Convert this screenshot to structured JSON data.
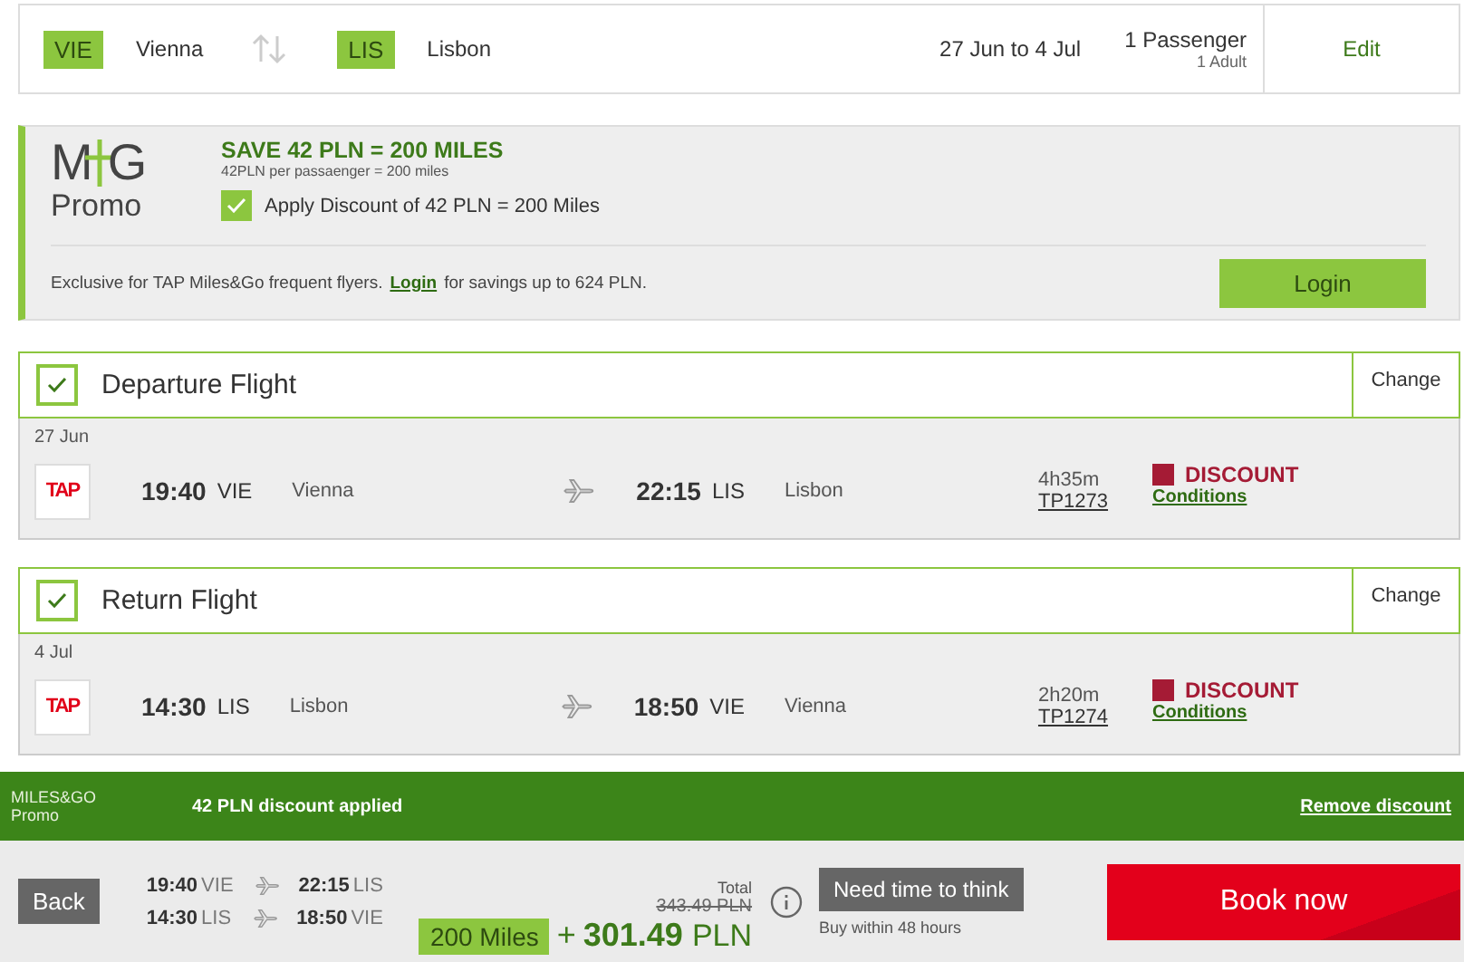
{
  "search_summary": {
    "origin_code": "VIE",
    "origin_city": "Vienna",
    "destination_code": "LIS",
    "destination_city": "Lisbon",
    "dates": "27 Jun to 4 Jul",
    "passengers": "1 Passenger",
    "passenger_detail": "1 Adult",
    "edit": "Edit"
  },
  "promo": {
    "logo": {
      "left": "M",
      "right": "G",
      "caption": "Promo"
    },
    "title": "SAVE 42 PLN = 200 MILES",
    "subtitle": "42PLN per passaenger = 200 miles",
    "apply_label": "Apply Discount of 42 PLN = 200 Miles",
    "apply_checked": true,
    "note_before": "Exclusive for TAP Miles&Go frequent flyers.",
    "note_link": "Login",
    "note_after": "for savings up to 624 PLN.",
    "login_button": "Login"
  },
  "flights": [
    {
      "title": "Departure Flight",
      "checked": true,
      "change": "Change",
      "date": "27 Jun",
      "airline": "TAP",
      "dep_time": "19:40",
      "dep_code": "VIE",
      "dep_city": "Vienna",
      "arr_time": "22:15",
      "arr_code": "LIS",
      "arr_city": "Lisbon",
      "duration": "4h35m",
      "flight_number": "TP1273",
      "fare": "DISCOUNT",
      "conditions": "Conditions"
    },
    {
      "title": "Return Flight",
      "checked": true,
      "change": "Change",
      "date": "4 Jul",
      "airline": "TAP",
      "dep_time": "14:30",
      "dep_code": "LIS",
      "dep_city": "Lisbon",
      "arr_time": "18:50",
      "arr_code": "VIE",
      "arr_city": "Vienna",
      "duration": "2h20m",
      "flight_number": "TP1274",
      "fare": "DISCOUNT",
      "conditions": "Conditions"
    }
  ],
  "discount_bar": {
    "brand": "MILES&GO",
    "brand_caption": "Promo",
    "message": "42 PLN discount applied",
    "remove": "Remove discount"
  },
  "booking_bar": {
    "back": "Back",
    "legs": [
      {
        "dep_time": "19:40",
        "dep_code": "VIE",
        "arr_time": "22:15",
        "arr_code": "LIS"
      },
      {
        "dep_time": "14:30",
        "dep_code": "LIS",
        "arr_time": "18:50",
        "arr_code": "VIE"
      }
    ],
    "total_label": "Total",
    "old_price": "343.49 PLN",
    "miles": "200 Miles",
    "plus": "+",
    "price": "301.49",
    "currency": "PLN",
    "think_button": "Need time to think",
    "think_note": "Buy within 48 hours",
    "book_button": "Book now"
  }
}
